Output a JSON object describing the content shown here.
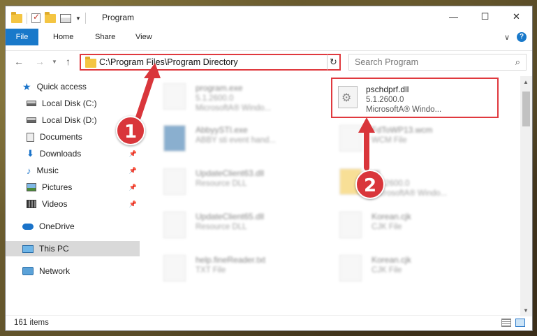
{
  "window": {
    "title": "Program",
    "controls": [
      "—",
      "☐",
      "✕"
    ]
  },
  "ribbon": {
    "tabs": [
      "File",
      "Home",
      "Share",
      "View"
    ]
  },
  "navigation": {
    "address": "C:\\Program Files\\Program Directory",
    "search_placeholder": "Search Program"
  },
  "sidebar": {
    "items": [
      {
        "label": "Quick access",
        "icon": "star-icon"
      },
      {
        "label": "Local Disk (C:)",
        "icon": "drive-icon"
      },
      {
        "label": "Local Disk (D:)",
        "icon": "drive-icon"
      },
      {
        "label": "Documents",
        "icon": "documents-icon"
      },
      {
        "label": "Downloads",
        "icon": "download-icon"
      },
      {
        "label": "Music",
        "icon": "music-icon"
      },
      {
        "label": "Pictures",
        "icon": "pictures-icon"
      },
      {
        "label": "Videos",
        "icon": "videos-icon"
      },
      {
        "label": "OneDrive",
        "icon": "cloud-icon"
      },
      {
        "label": "This PC",
        "icon": "computer-icon"
      },
      {
        "label": "Network",
        "icon": "network-icon"
      }
    ]
  },
  "files": [
    {
      "name": "program.exe",
      "line1": "5.1.2600.0",
      "line2": "MicrosoftA® Windo..."
    },
    {
      "name": "pschdprf.dll",
      "line1": "5.1.2600.0",
      "line2": "MicrosoftA® Windo..."
    },
    {
      "name": "AbbyySTI.exe",
      "line1": "ABBY sti event hand...",
      "line2": ""
    },
    {
      "name": "FdToWP13.wcm",
      "line1": "WCM File",
      "line2": ""
    },
    {
      "name": "UpdateClient63.dll",
      "line1": "Resource DLL",
      "line2": ""
    },
    {
      "name": "dll",
      "line1": "5.1.2600.0",
      "line2": "MicrosoftA® Windo..."
    },
    {
      "name": "UpdateClient65.dll",
      "line1": "Resource DLL",
      "line2": ""
    },
    {
      "name": "Korean.cjk",
      "line1": "CJK File",
      "line2": ""
    },
    {
      "name": "help.fineReader.txt",
      "line1": "TXT File",
      "line2": ""
    },
    {
      "name": "Korean.cjk",
      "line1": "CJK File",
      "line2": ""
    }
  ],
  "status": {
    "item_count": "161 items"
  },
  "annotations": {
    "step1": "1",
    "step2": "2",
    "accent": "#d9363b"
  }
}
